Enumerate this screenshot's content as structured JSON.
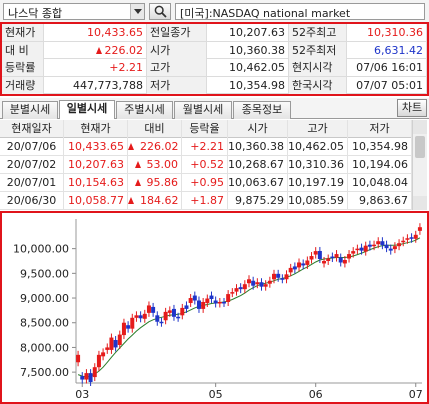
{
  "topbar": {
    "index_name": "나스닥 종합",
    "market_name": "[미국]:NASDAQ national market"
  },
  "quote": {
    "rows": [
      [
        {
          "label": "현재가",
          "value": "10,433.65",
          "color": "up",
          "arrow": false
        },
        {
          "label": "전일종가",
          "value": "10,207.63",
          "color": "",
          "arrow": false
        },
        {
          "label": "52주최고",
          "value": "10,310.36",
          "color": "up",
          "arrow": false
        }
      ],
      [
        {
          "label": "대  비",
          "value": "226.02",
          "color": "up",
          "arrow": true
        },
        {
          "label": "시가",
          "value": "10,360.38",
          "color": "",
          "arrow": false
        },
        {
          "label": "52주최저",
          "value": "6,631.42",
          "color": "down",
          "arrow": false
        }
      ],
      [
        {
          "label": "등락률",
          "value": "+2.21",
          "color": "up",
          "arrow": false
        },
        {
          "label": "고가",
          "value": "10,462.05",
          "color": "",
          "arrow": false
        },
        {
          "label": "현지시각",
          "value": "07/06 16:01",
          "color": "",
          "arrow": false
        }
      ],
      [
        {
          "label": "거래량",
          "value": "447,773,788",
          "color": "",
          "arrow": false
        },
        {
          "label": "저가",
          "value": "10,354.98",
          "color": "",
          "arrow": false
        },
        {
          "label": "한국시각",
          "value": "07/07 05:01",
          "color": "",
          "arrow": false
        }
      ]
    ]
  },
  "tabs": {
    "items": [
      "분별시세",
      "일별시세",
      "주별시세",
      "월별시세",
      "종목정보"
    ],
    "active_index": 1,
    "chart_button": "차트"
  },
  "table": {
    "headers": [
      "현재일자",
      "현재가",
      "대비",
      "등락율",
      "시가",
      "고가",
      "저가"
    ],
    "rows": [
      {
        "date": "20/07/06",
        "price": "10,433.65",
        "change": "226.02",
        "rate": "+2.21",
        "open": "10,360.38",
        "high": "10,462.05",
        "low": "10,354.98"
      },
      {
        "date": "20/07/02",
        "price": "10,207.63",
        "change": "53.00",
        "rate": "+0.52",
        "open": "10,268.67",
        "high": "10,310.36",
        "low": "10,194.06"
      },
      {
        "date": "20/07/01",
        "price": "10,154.63",
        "change": "95.86",
        "rate": "+0.95",
        "open": "10,063.67",
        "high": "10,197.19",
        "low": "10,048.04"
      },
      {
        "date": "20/06/30",
        "price": "10,058.77",
        "change": "184.62",
        "rate": "+1.87",
        "open": "9,875.29",
        "high": "10,085.59",
        "low": "9,863.67"
      }
    ]
  },
  "colors": {
    "up": "#e51b1b",
    "down": "#1f35c9",
    "ma_short": "#2a7d2a",
    "ma_long": "#5577dd",
    "highlight_border": "#e0141b"
  },
  "chart_data": {
    "type": "candlestick",
    "y_ticks": [
      "10,000.00",
      "9,500.00",
      "9,000.00",
      "8,500.00",
      "8,000.00",
      "7,500.00"
    ],
    "y_tick_values": [
      10000,
      9500,
      9000,
      8500,
      8000,
      7500
    ],
    "ylim": [
      7280,
      10600
    ],
    "x_tick_labels": [
      "03",
      "05",
      "06",
      "07"
    ],
    "x_tick_positions": [
      1,
      33,
      57,
      81
    ],
    "candles": [
      [
        7700,
        7850
      ],
      [
        7420,
        7350
      ],
      [
        7350,
        7480
      ],
      [
        7480,
        7300
      ],
      [
        7400,
        7600
      ],
      [
        7600,
        7850
      ],
      [
        7820,
        7900
      ],
      [
        7950,
        8000
      ],
      [
        7950,
        8200
      ],
      [
        8150,
        8000
      ],
      [
        8050,
        8260
      ],
      [
        8250,
        8500
      ],
      [
        8450,
        8380
      ],
      [
        8380,
        8600
      ],
      [
        8600,
        8650
      ],
      [
        8650,
        8590
      ],
      [
        8580,
        8680
      ],
      [
        8700,
        8850
      ],
      [
        8820,
        8700
      ],
      [
        8650,
        8520
      ],
      [
        8520,
        8500
      ],
      [
        8550,
        8720
      ],
      [
        8700,
        8750
      ],
      [
        8780,
        8620
      ],
      [
        8620,
        8600
      ],
      [
        8650,
        8800
      ],
      [
        8850,
        8780
      ],
      [
        8900,
        9000
      ],
      [
        9050,
        8950
      ],
      [
        8950,
        8780
      ],
      [
        8780,
        8920
      ],
      [
        8900,
        8990
      ],
      [
        9050,
        8980
      ],
      [
        8950,
        8890
      ],
      [
        8890,
        8920
      ],
      [
        8920,
        8900
      ],
      [
        8920,
        9080
      ],
      [
        9100,
        9120
      ],
      [
        9130,
        9200
      ],
      [
        9220,
        9180
      ],
      [
        9180,
        9280
      ],
      [
        9300,
        9380
      ],
      [
        9350,
        9250
      ],
      [
        9280,
        9320
      ],
      [
        9320,
        9230
      ],
      [
        9230,
        9280
      ],
      [
        9290,
        9350
      ],
      [
        9380,
        9490
      ],
      [
        9490,
        9410
      ],
      [
        9400,
        9380
      ],
      [
        9380,
        9480
      ],
      [
        9520,
        9610
      ],
      [
        9640,
        9580
      ],
      [
        9620,
        9720
      ],
      [
        9700,
        9660
      ],
      [
        9670,
        9760
      ],
      [
        9780,
        9850
      ],
      [
        9880,
        9950
      ],
      [
        9953,
        9790
      ],
      [
        9700,
        9750
      ],
      [
        9750,
        9800
      ],
      [
        9840,
        9810
      ],
      [
        9820,
        9890
      ],
      [
        9820,
        9720
      ],
      [
        9700,
        9770
      ],
      [
        9800,
        9890
      ],
      [
        9900,
        9950
      ],
      [
        9970,
        10000
      ],
      [
        10020,
        9960
      ],
      [
        9940,
        10060
      ],
      [
        10080,
        10040
      ],
      [
        10050,
        10080
      ],
      [
        10090,
        10150
      ],
      [
        10150,
        10070
      ],
      [
        10080,
        10010
      ],
      [
        10000,
        9960
      ],
      [
        9990,
        10050
      ],
      [
        10050,
        10110
      ],
      [
        10130,
        10160
      ],
      [
        10180,
        10210
      ],
      [
        10230,
        10200
      ],
      [
        10200,
        10280
      ],
      [
        10360,
        10434
      ]
    ],
    "ma_short": [
      7450,
      7420,
      7400,
      7420,
      7460,
      7520,
      7600,
      7700,
      7800,
      7900,
      7990,
      8080,
      8170,
      8250,
      8330,
      8400,
      8460,
      8520,
      8560,
      8590,
      8610,
      8630,
      8650,
      8660,
      8670,
      8690,
      8720,
      8760,
      8800,
      8830,
      8850,
      8870,
      8890,
      8900,
      8910,
      8920,
      8940,
      8970,
      9010,
      9050,
      9100,
      9160,
      9210,
      9250,
      9280,
      9300,
      9320,
      9350,
      9380,
      9400,
      9420,
      9450,
      9490,
      9540,
      9590,
      9630,
      9680,
      9730,
      9770,
      9790,
      9800,
      9810,
      9820,
      9820,
      9820,
      9830,
      9850,
      9880,
      9910,
      9940,
      9980,
      10010,
      10040,
      10060,
      10070,
      10070,
      10070,
      10080,
      10100,
      10120,
      10140,
      10170,
      10220
    ]
  }
}
